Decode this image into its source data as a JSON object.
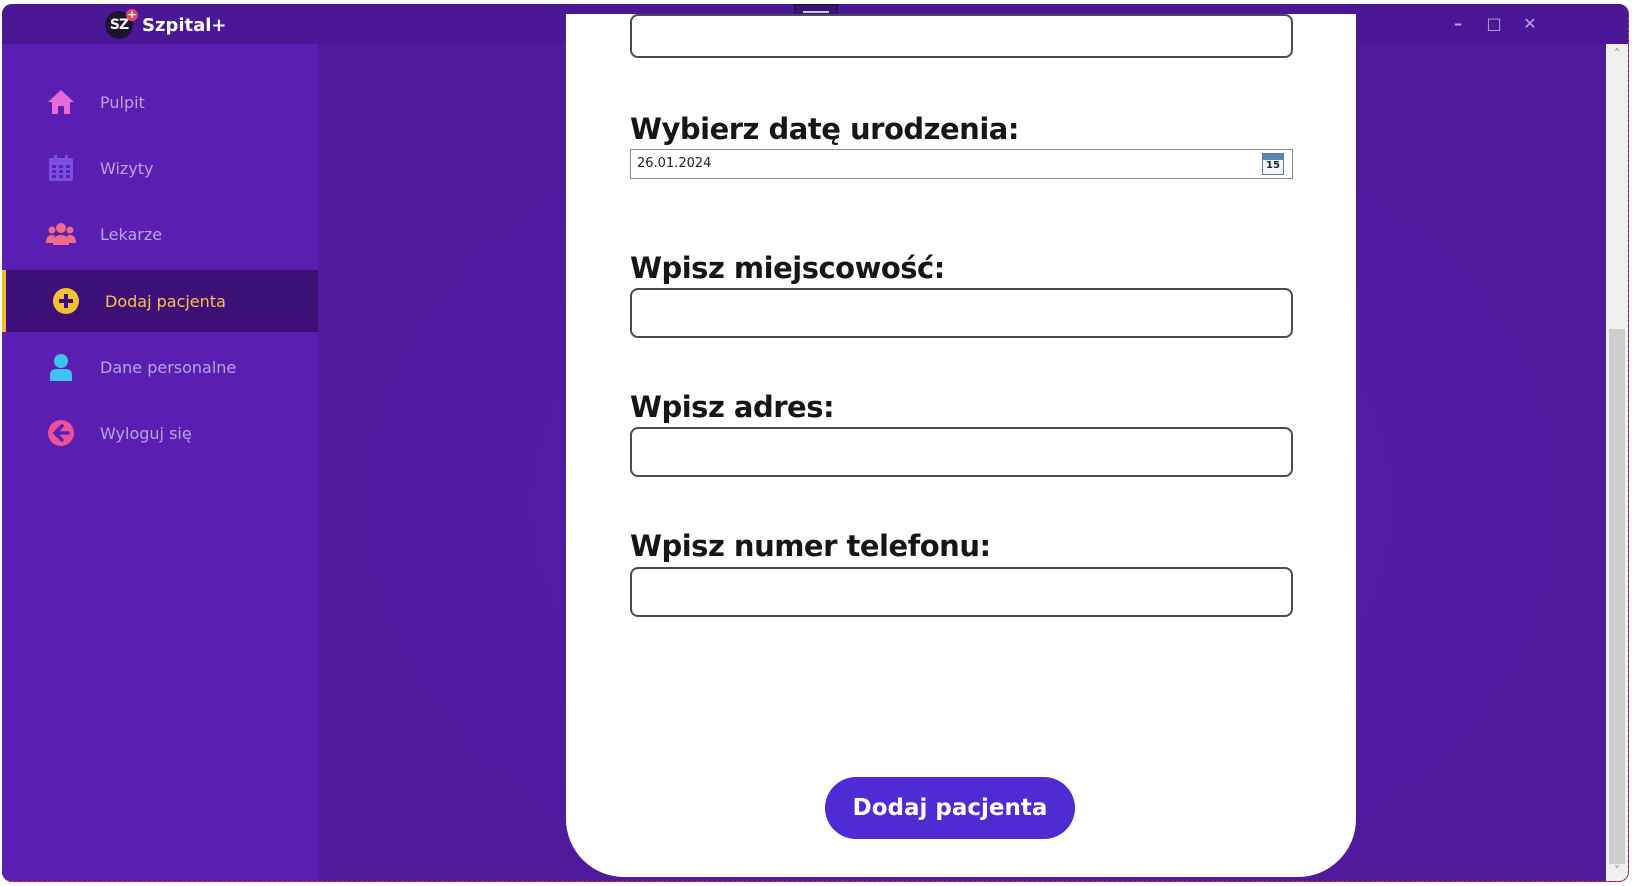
{
  "app": {
    "logo_text": "SZ",
    "logo_badge": "+",
    "title": "Szpital+"
  },
  "window_controls": {
    "minimize": "–",
    "maximize": "□",
    "close": "✕"
  },
  "sidebar": {
    "items": [
      {
        "label": "Pulpit",
        "icon": "home-icon",
        "color": "#e86ad6"
      },
      {
        "label": "Wizyty",
        "icon": "calendar-icon",
        "color": "#7b4fe0"
      },
      {
        "label": "Lekarze",
        "icon": "users-icon",
        "color": "#f06a8a"
      },
      {
        "label": "Dodaj pacjenta",
        "icon": "plus-circle-icon",
        "color": "#f4c030",
        "active": true
      },
      {
        "label": "Dane personalne",
        "icon": "user-icon",
        "color": "#3fc2ee"
      },
      {
        "label": "Wyloguj się",
        "icon": "logout-icon",
        "color": "#f04f9a"
      }
    ]
  },
  "form": {
    "birthdate_label": "Wybierz datę urodzenia:",
    "birthdate_value": "26.01.2024",
    "calendar_day": "15",
    "city_label": "Wpisz miejscowość:",
    "city_value": "",
    "address_label": "Wpisz adres:",
    "address_value": "",
    "phone_label": "Wpisz numer telefonu:",
    "phone_value": "",
    "submit_label": "Dodaj pacjenta"
  },
  "scrollbar": {
    "up": "˄",
    "down": "˅"
  },
  "colors": {
    "sidebar_bg": "#5a1eb3",
    "active_bg": "#3c1076",
    "active_accent": "#f4b92f",
    "button_bg": "#4f2bd4"
  }
}
